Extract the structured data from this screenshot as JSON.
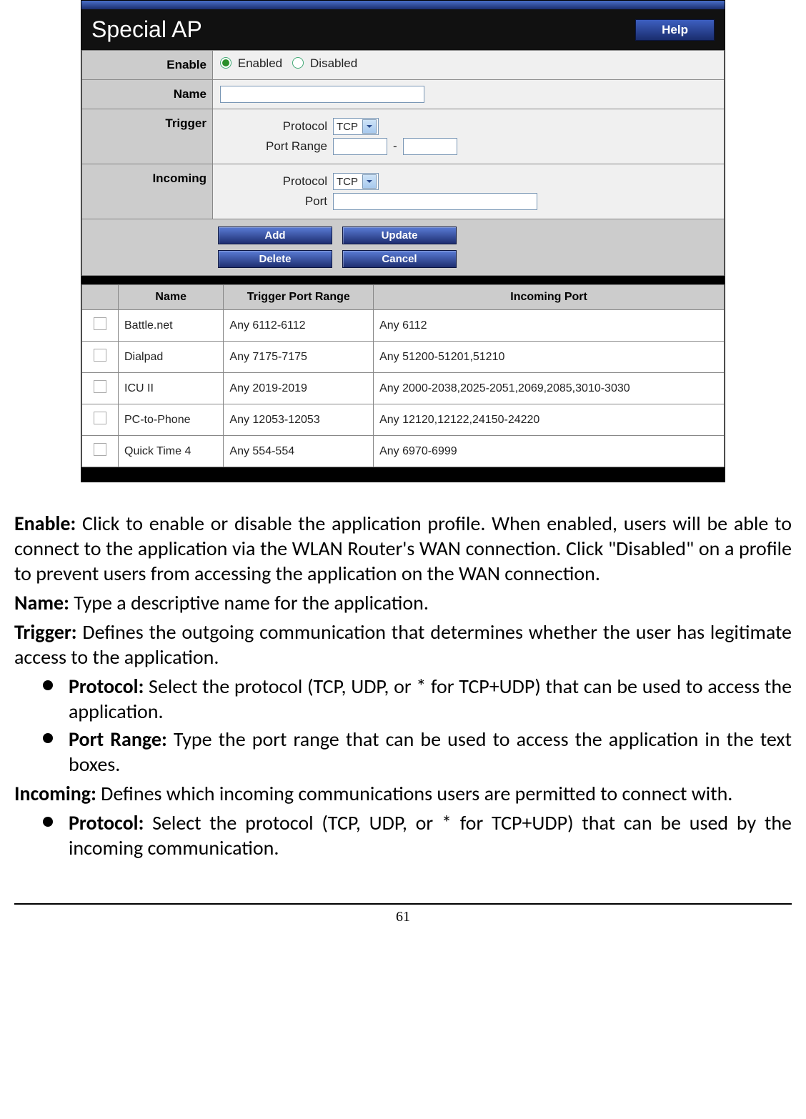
{
  "page_number": "61",
  "router": {
    "title": "Special AP",
    "help_label": "Help",
    "form": {
      "enable_label": "Enable",
      "enabled_option": "Enabled",
      "disabled_option": "Disabled",
      "name_label": "Name",
      "name_value": "",
      "trigger_label": "Trigger",
      "trigger_protocol_label": "Protocol",
      "trigger_protocol_value": "TCP",
      "trigger_portrange_label": "Port Range",
      "trigger_port_from": "",
      "trigger_port_to": "",
      "incoming_label": "Incoming",
      "incoming_protocol_label": "Protocol",
      "incoming_protocol_value": "TCP",
      "incoming_port_label": "Port",
      "incoming_port_value": ""
    },
    "buttons": {
      "add": "Add",
      "update": "Update",
      "delete": "Delete",
      "cancel": "Cancel"
    },
    "list": {
      "col_name": "Name",
      "col_trigger": "Trigger Port Range",
      "col_incoming": "Incoming Port",
      "rows": [
        {
          "name": "Battle.net",
          "trigger": "Any 6112-6112",
          "incoming": "Any 6112"
        },
        {
          "name": "Dialpad",
          "trigger": "Any 7175-7175",
          "incoming": "Any 51200-51201,51210"
        },
        {
          "name": "ICU II",
          "trigger": "Any 2019-2019",
          "incoming": "Any 2000-2038,2025-2051,2069,2085,3010-3030"
        },
        {
          "name": "PC-to-Phone",
          "trigger": "Any 12053-12053",
          "incoming": "Any 12120,12122,24150-24220"
        },
        {
          "name": "Quick Time 4",
          "trigger": "Any 554-554",
          "incoming": "Any 6970-6999"
        }
      ]
    }
  },
  "doc": {
    "enable_term": "Enable:",
    "enable_text": " Click to enable or disable the application profile. When enabled, users will be able to connect to the application via the WLAN Router's WAN connection. Click \"Disabled\" on a profile to prevent users from accessing the application on the WAN connection.",
    "name_term": "Name:",
    "name_text": " Type a descriptive name for the application.",
    "trigger_term": "Trigger:",
    "trigger_text": " Defines the outgoing communication that determines whether the user has legitimate access to the application.",
    "t_proto_term": "Protocol:",
    "t_proto_text": " Select the protocol (TCP, UDP, or * for TCP+UDP) that can be used to access the application.",
    "t_pr_term": "Port Range:",
    "t_pr_text": " Type the port range that can be used to access the application in the text boxes.",
    "incoming_term": "Incoming:",
    "incoming_text": " Defines which incoming communications users are permitted to connect with.",
    "i_proto_term": "Protocol:",
    "i_proto_text": " Select the protocol (TCP, UDP, or * for TCP+UDP) that can be used by the incoming communication."
  }
}
